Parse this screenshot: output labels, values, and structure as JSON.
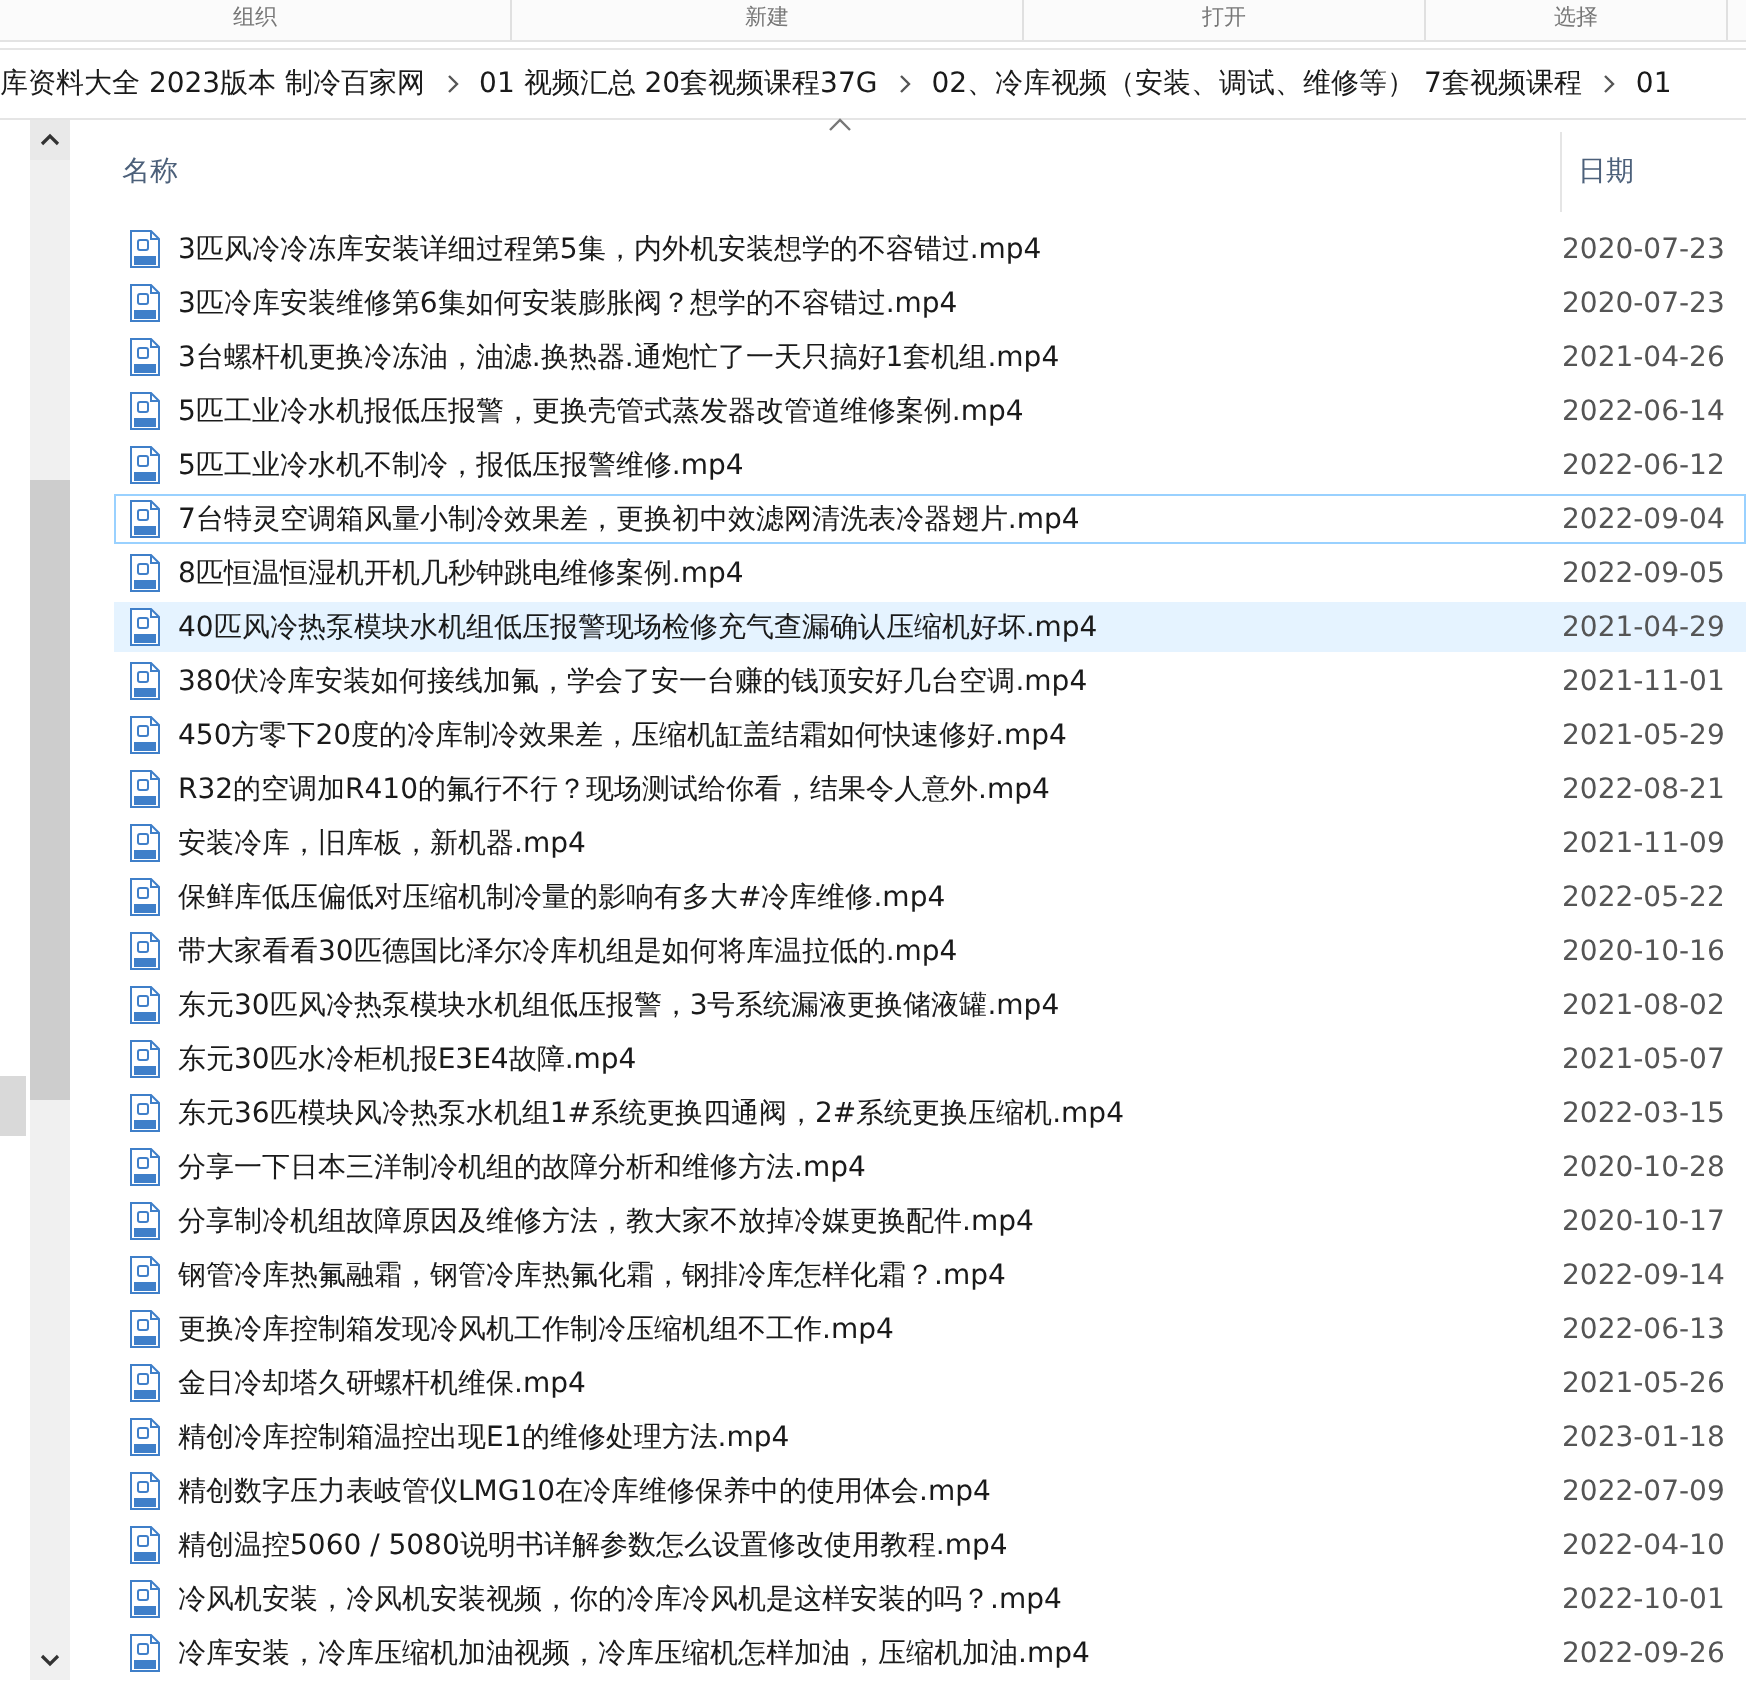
{
  "ribbon_groups": [
    "组织",
    "新建",
    "打开",
    "选择"
  ],
  "breadcrumb": [
    "库资料大全 2023版本 制冷百家网",
    "01 视频汇总 20套视频课程37G",
    "02、冷库视频（安装、调试、维修等） 7套视频课程",
    "01"
  ],
  "columns": {
    "name": "名称",
    "date": "日期"
  },
  "files": [
    {
      "name": "3匹风冷冷冻库安装详细过程第5集，内外机安装想学的不容错过.mp4",
      "date": "2020-07-23",
      "selected": false,
      "focused": false
    },
    {
      "name": "3匹冷库安装维修第6集如何安装膨胀阀？想学的不容错过.mp4",
      "date": "2020-07-23",
      "selected": false,
      "focused": false
    },
    {
      "name": "3台螺杆机更换冷冻油，油滤.换热器.通炮忙了一天只搞好1套机组.mp4",
      "date": "2021-04-26",
      "selected": false,
      "focused": false
    },
    {
      "name": "5匹工业冷水机报低压报警，更换壳管式蒸发器改管道维修案例.mp4",
      "date": "2022-06-14",
      "selected": false,
      "focused": false
    },
    {
      "name": "5匹工业冷水机不制冷，报低压报警维修.mp4",
      "date": "2022-06-12",
      "selected": false,
      "focused": false
    },
    {
      "name": "7台特灵空调箱风量小制冷效果差，更换初中效滤网清洗表冷器翅片.mp4",
      "date": "2022-09-04",
      "selected": false,
      "focused": true
    },
    {
      "name": "8匹恒温恒湿机开机几秒钟跳电维修案例.mp4",
      "date": "2022-09-05",
      "selected": false,
      "focused": false
    },
    {
      "name": "40匹风冷热泵模块水机组低压报警现场检修充气查漏确认压缩机好坏.mp4",
      "date": "2021-04-29",
      "selected": true,
      "focused": false
    },
    {
      "name": "380伏冷库安装如何接线加氟，学会了安一台赚的钱顶安好几台空调.mp4",
      "date": "2021-11-01",
      "selected": false,
      "focused": false
    },
    {
      "name": "450方零下20度的冷库制冷效果差，压缩机缸盖结霜如何快速修好.mp4",
      "date": "2021-05-29",
      "selected": false,
      "focused": false
    },
    {
      "name": "R32的空调加R410的氟行不行？现场测试给你看，结果令人意外.mp4",
      "date": "2022-08-21",
      "selected": false,
      "focused": false
    },
    {
      "name": "安装冷库，旧库板，新机器.mp4",
      "date": "2021-11-09",
      "selected": false,
      "focused": false
    },
    {
      "name": "保鲜库低压偏低对压缩机制冷量的影响有多大#冷库维修.mp4",
      "date": "2022-05-22",
      "selected": false,
      "focused": false
    },
    {
      "name": "带大家看看30匹德国比泽尔冷库机组是如何将库温拉低的.mp4",
      "date": "2020-10-16",
      "selected": false,
      "focused": false
    },
    {
      "name": "东元30匹风冷热泵模块水机组低压报警，3号系统漏液更换储液罐.mp4",
      "date": "2021-08-02",
      "selected": false,
      "focused": false
    },
    {
      "name": "东元30匹水冷柜机报E3E4故障.mp4",
      "date": "2021-05-07",
      "selected": false,
      "focused": false
    },
    {
      "name": "东元36匹模块风冷热泵水机组1#系统更换四通阀，2#系统更换压缩机.mp4",
      "date": "2022-03-15",
      "selected": false,
      "focused": false
    },
    {
      "name": "分享一下日本三洋制冷机组的故障分析和维修方法.mp4",
      "date": "2020-10-28",
      "selected": false,
      "focused": false
    },
    {
      "name": "分享制冷机组故障原因及维修方法，教大家不放掉冷媒更换配件.mp4",
      "date": "2020-10-17",
      "selected": false,
      "focused": false
    },
    {
      "name": "钢管冷库热氟融霜，钢管冷库热氟化霜，钢排冷库怎样化霜？.mp4",
      "date": "2022-09-14",
      "selected": false,
      "focused": false
    },
    {
      "name": "更换冷库控制箱发现冷风机工作制冷压缩机组不工作.mp4",
      "date": "2022-06-13",
      "selected": false,
      "focused": false
    },
    {
      "name": "金日冷却塔久研螺杆机维保.mp4",
      "date": "2021-05-26",
      "selected": false,
      "focused": false
    },
    {
      "name": "精创冷库控制箱温控出现E1的维修处理方法.mp4",
      "date": "2023-01-18",
      "selected": false,
      "focused": false
    },
    {
      "name": "精创数字压力表岐管仪LMG10在冷库维修保养中的使用体会.mp4",
      "date": "2022-07-09",
      "selected": false,
      "focused": false
    },
    {
      "name": "精创温控5060 / 5080说明书详解参数怎么设置修改使用教程.mp4",
      "date": "2022-04-10",
      "selected": false,
      "focused": false
    },
    {
      "name": "冷风机安装，冷风机安装视频，你的冷库冷风机是这样安装的吗？.mp4",
      "date": "2022-10-01",
      "selected": false,
      "focused": false
    },
    {
      "name": "冷库安装，冷库压缩机加油视频，冷库压缩机怎样加油，压缩机加油.mp4",
      "date": "2022-09-26",
      "selected": false,
      "focused": false
    }
  ]
}
